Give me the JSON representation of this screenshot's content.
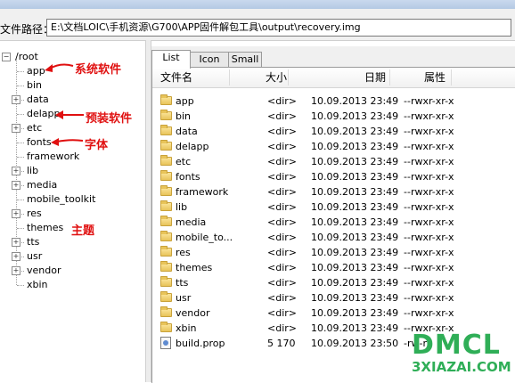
{
  "window": {
    "title": ""
  },
  "pathbar": {
    "label": "文件路径：",
    "value": "E:\\文档LOIC\\手机资源\\G700\\APP固件解包工具\\output\\recovery.img"
  },
  "tree": {
    "root": "/root",
    "items": [
      {
        "label": "app",
        "expander": ""
      },
      {
        "label": "bin",
        "expander": ""
      },
      {
        "label": "data",
        "expander": "+"
      },
      {
        "label": "delapp",
        "expander": ""
      },
      {
        "label": "etc",
        "expander": "+"
      },
      {
        "label": "fonts",
        "expander": ""
      },
      {
        "label": "framework",
        "expander": ""
      },
      {
        "label": "lib",
        "expander": "+"
      },
      {
        "label": "media",
        "expander": "+"
      },
      {
        "label": "mobile_toolkit",
        "expander": ""
      },
      {
        "label": "res",
        "expander": "+"
      },
      {
        "label": "themes",
        "expander": ""
      },
      {
        "label": "tts",
        "expander": "+"
      },
      {
        "label": "usr",
        "expander": "+"
      },
      {
        "label": "vendor",
        "expander": "+"
      },
      {
        "label": "xbin",
        "expander": ""
      }
    ]
  },
  "annotations": {
    "system_software": "系统软件",
    "preinstalled_software": "预装软件",
    "fonts": "字体",
    "theme": "主题"
  },
  "tabs": [
    {
      "label": "List",
      "active": true
    },
    {
      "label": "Icon",
      "active": false
    },
    {
      "label": "Small",
      "active": false
    }
  ],
  "columns": {
    "name": "文件名",
    "size": "大小",
    "date": "日期",
    "attr": "属性"
  },
  "files": [
    {
      "name": "app",
      "size": "<dir>",
      "date": "10.09.2013 23:49",
      "attr": "--rwxr-xr-x",
      "type": "folder"
    },
    {
      "name": "bin",
      "size": "<dir>",
      "date": "10.09.2013 23:49",
      "attr": "--rwxr-xr-x",
      "type": "folder"
    },
    {
      "name": "data",
      "size": "<dir>",
      "date": "10.09.2013 23:49",
      "attr": "--rwxr-xr-x",
      "type": "folder"
    },
    {
      "name": "delapp",
      "size": "<dir>",
      "date": "10.09.2013 23:49",
      "attr": "--rwxr-xr-x",
      "type": "folder"
    },
    {
      "name": "etc",
      "size": "<dir>",
      "date": "10.09.2013 23:49",
      "attr": "--rwxr-xr-x",
      "type": "folder"
    },
    {
      "name": "fonts",
      "size": "<dir>",
      "date": "10.09.2013 23:49",
      "attr": "--rwxr-xr-x",
      "type": "folder"
    },
    {
      "name": "framework",
      "size": "<dir>",
      "date": "10.09.2013 23:49",
      "attr": "--rwxr-xr-x",
      "type": "folder"
    },
    {
      "name": "lib",
      "size": "<dir>",
      "date": "10.09.2013 23:49",
      "attr": "--rwxr-xr-x",
      "type": "folder"
    },
    {
      "name": "media",
      "size": "<dir>",
      "date": "10.09.2013 23:49",
      "attr": "--rwxr-xr-x",
      "type": "folder"
    },
    {
      "name": "mobile_to...",
      "size": "<dir>",
      "date": "10.09.2013 23:49",
      "attr": "--rwxr-xr-x",
      "type": "folder"
    },
    {
      "name": "res",
      "size": "<dir>",
      "date": "10.09.2013 23:49",
      "attr": "--rwxr-xr-x",
      "type": "folder"
    },
    {
      "name": "themes",
      "size": "<dir>",
      "date": "10.09.2013 23:49",
      "attr": "--rwxr-xr-x",
      "type": "folder"
    },
    {
      "name": "tts",
      "size": "<dir>",
      "date": "10.09.2013 23:49",
      "attr": "--rwxr-xr-x",
      "type": "folder"
    },
    {
      "name": "usr",
      "size": "<dir>",
      "date": "10.09.2013 23:49",
      "attr": "--rwxr-xr-x",
      "type": "folder"
    },
    {
      "name": "vendor",
      "size": "<dir>",
      "date": "10.09.2013 23:49",
      "attr": "--rwxr-xr-x",
      "type": "folder"
    },
    {
      "name": "xbin",
      "size": "<dir>",
      "date": "10.09.2013 23:49",
      "attr": "--rwxr-xr-x",
      "type": "folder"
    },
    {
      "name": "build.prop",
      "size": "5 170",
      "date": "10.09.2013 23:50",
      "attr": "-rw-r",
      "type": "file"
    }
  ],
  "watermark": {
    "line1": "DMCL",
    "line2": "3XIAZAI.COM"
  },
  "colors": {
    "annotation": "#e01010",
    "watermark": "#2fae57",
    "folder": "#e8c45a"
  }
}
